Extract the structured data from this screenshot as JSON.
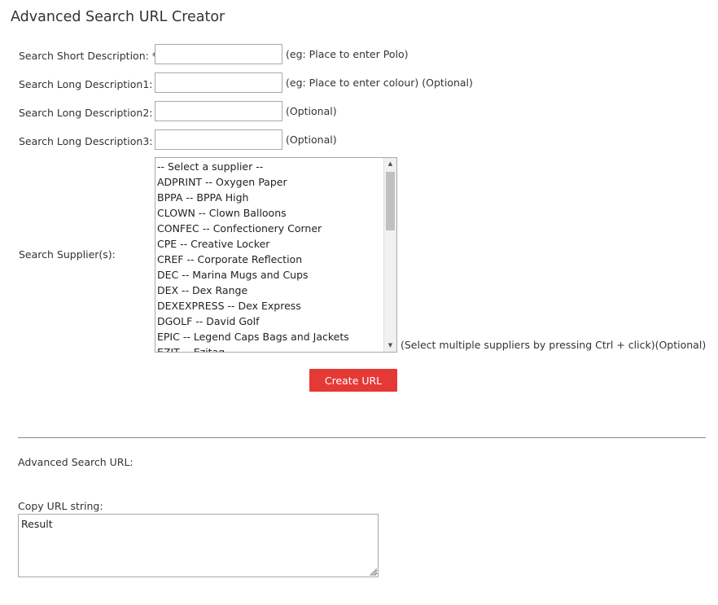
{
  "page": {
    "title": "Advanced Search URL Creator"
  },
  "form": {
    "short_desc": {
      "label": "Search Short Description: *",
      "value": "",
      "hint": "(eg: Place to enter Polo)"
    },
    "long_desc1": {
      "label": "Search Long Description1:",
      "value": "",
      "hint": "(eg: Place to enter colour) (Optional)"
    },
    "long_desc2": {
      "label": "Search Long Description2:",
      "value": "",
      "hint": "(Optional)"
    },
    "long_desc3": {
      "label": "Search Long Description3:",
      "value": "",
      "hint": "(Optional)"
    },
    "suppliers": {
      "label": "Search Supplier(s):",
      "hint": "(Select multiple suppliers by pressing Ctrl + click)(Optional)",
      "options": [
        "-- Select a supplier --",
        "ADPRINT -- Oxygen Paper",
        "BPPA -- BPPA High",
        "CLOWN -- Clown Balloons",
        "CONFEC -- Confectionery Corner",
        "CPE -- Creative Locker",
        "CREF -- Corporate Reflection",
        "DEC -- Marina Mugs and Cups",
        "DEX -- Dex Range",
        "DEXEXPRESS -- Dex Express",
        "DGOLF -- David Golf",
        "EPIC -- Legend Caps Bags and Jackets",
        "EZIT -- Ezitag"
      ]
    },
    "create_button": "Create URL"
  },
  "output": {
    "url_label": "Advanced Search URL:",
    "copy_label": "Copy URL string:",
    "result_value": "Result"
  },
  "colors": {
    "accent": "#e53935",
    "text": "#333333",
    "border": "#a9a9a9"
  }
}
